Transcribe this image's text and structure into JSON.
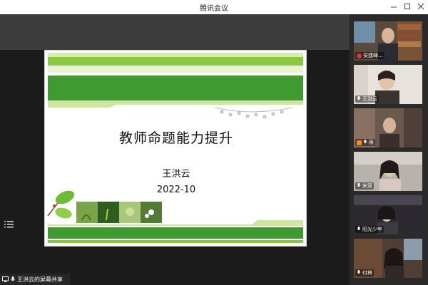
{
  "window": {
    "title": "腾讯会议"
  },
  "slide": {
    "title": "教师命题能力提升",
    "author": "王洪云",
    "date": "2022-10"
  },
  "share_bar": {
    "label": "王洪云的屏幕共享"
  },
  "participants": [
    {
      "name": "安建峰…"
    },
    {
      "name": "王洪云"
    },
    {
      "name": "蒋"
    },
    {
      "name": "宋双"
    },
    {
      "name": "阳光少年"
    },
    {
      "name": "付林"
    }
  ],
  "colors": {
    "slide_green": "#3f9a2f",
    "slide_light_green": "#cde6a0",
    "panel_bg": "#2a2a2a"
  },
  "icons": [
    "minimize-icon",
    "maximize-icon",
    "close-icon",
    "menu-icon",
    "screen-share-icon",
    "microphone-icon"
  ]
}
